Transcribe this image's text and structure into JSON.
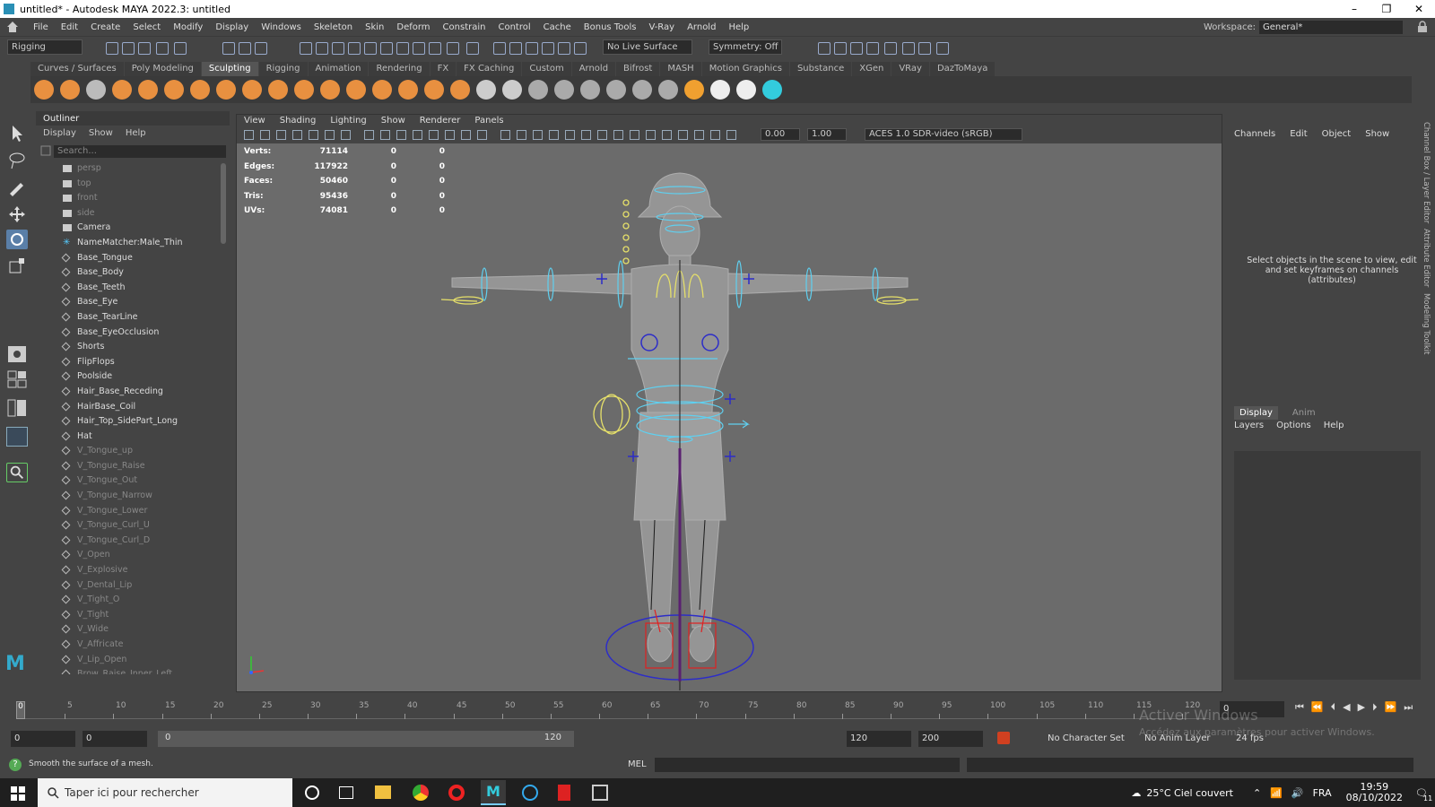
{
  "titlebar": {
    "title": "untitled* - Autodesk MAYA 2022.3: untitled",
    "min": "–",
    "max": "❐",
    "close": "✕"
  },
  "menubar": {
    "items": [
      "File",
      "Edit",
      "Create",
      "Select",
      "Modify",
      "Display",
      "Windows",
      "Skeleton",
      "Skin",
      "Deform",
      "Constrain",
      "Control",
      "Cache",
      "Bonus Tools",
      "V-Ray",
      "Arnold",
      "Help"
    ],
    "workspace_label": "Workspace:",
    "workspace_value": "General*"
  },
  "statusline": {
    "menuset": "Rigging",
    "live_surface": "No Live Surface",
    "symmetry": "Symmetry: Off"
  },
  "shelf": {
    "tabs": [
      "Curves / Surfaces",
      "Poly Modeling",
      "Sculpting",
      "Rigging",
      "Animation",
      "Rendering",
      "FX",
      "FX Caching",
      "Custom",
      "Arnold",
      "Bifrost",
      "MASH",
      "Motion Graphics",
      "Substance",
      "XGen",
      "VRay",
      "DazToMaya"
    ],
    "active_tab": "Sculpting"
  },
  "outliner": {
    "title": "Outliner",
    "menu": [
      "Display",
      "Show",
      "Help"
    ],
    "search_placeholder": "Search...",
    "items": [
      {
        "label": "persp",
        "dim": true,
        "type": "camera"
      },
      {
        "label": "top",
        "dim": true,
        "type": "camera"
      },
      {
        "label": "front",
        "dim": true,
        "type": "camera"
      },
      {
        "label": "side",
        "dim": true,
        "type": "camera"
      },
      {
        "label": "Camera",
        "dim": false,
        "type": "camera"
      },
      {
        "label": "NameMatcher:Male_Thin",
        "dim": false,
        "type": "joint"
      },
      {
        "label": "Base_Tongue",
        "dim": false,
        "type": "mesh"
      },
      {
        "label": "Base_Body",
        "dim": false,
        "type": "mesh"
      },
      {
        "label": "Base_Teeth",
        "dim": false,
        "type": "mesh"
      },
      {
        "label": "Base_Eye",
        "dim": false,
        "type": "mesh"
      },
      {
        "label": "Base_TearLine",
        "dim": false,
        "type": "mesh"
      },
      {
        "label": "Base_EyeOcclusion",
        "dim": false,
        "type": "mesh"
      },
      {
        "label": "Shorts",
        "dim": false,
        "type": "mesh"
      },
      {
        "label": "FlipFlops",
        "dim": false,
        "type": "mesh"
      },
      {
        "label": "Poolside",
        "dim": false,
        "type": "mesh"
      },
      {
        "label": "Hair_Base_Receding",
        "dim": false,
        "type": "mesh"
      },
      {
        "label": "HairBase_Coil",
        "dim": false,
        "type": "mesh"
      },
      {
        "label": "Hair_Top_SidePart_Long",
        "dim": false,
        "type": "mesh"
      },
      {
        "label": "Hat",
        "dim": false,
        "type": "mesh"
      },
      {
        "label": "V_Tongue_up",
        "dim": true,
        "type": "mesh"
      },
      {
        "label": "V_Tongue_Raise",
        "dim": true,
        "type": "mesh"
      },
      {
        "label": "V_Tongue_Out",
        "dim": true,
        "type": "mesh"
      },
      {
        "label": "V_Tongue_Narrow",
        "dim": true,
        "type": "mesh"
      },
      {
        "label": "V_Tongue_Lower",
        "dim": true,
        "type": "mesh"
      },
      {
        "label": "V_Tongue_Curl_U",
        "dim": true,
        "type": "mesh"
      },
      {
        "label": "V_Tongue_Curl_D",
        "dim": true,
        "type": "mesh"
      },
      {
        "label": "V_Open",
        "dim": true,
        "type": "mesh"
      },
      {
        "label": "V_Explosive",
        "dim": true,
        "type": "mesh"
      },
      {
        "label": "V_Dental_Lip",
        "dim": true,
        "type": "mesh"
      },
      {
        "label": "V_Tight_O",
        "dim": true,
        "type": "mesh"
      },
      {
        "label": "V_Tight",
        "dim": true,
        "type": "mesh"
      },
      {
        "label": "V_Wide",
        "dim": true,
        "type": "mesh"
      },
      {
        "label": "V_Affricate",
        "dim": true,
        "type": "mesh"
      },
      {
        "label": "V_Lip_Open",
        "dim": true,
        "type": "mesh"
      },
      {
        "label": "Brow_Raise_Inner_Left",
        "dim": true,
        "type": "mesh"
      }
    ]
  },
  "viewport": {
    "menu": [
      "View",
      "Shading",
      "Lighting",
      "Show",
      "Renderer",
      "Panels"
    ],
    "field1": "0.00",
    "field2": "1.00",
    "colorspace": "ACES 1.0 SDR-video (sRGB)",
    "hud": [
      {
        "label": "Verts:",
        "value": "71114",
        "a": "0",
        "b": "0"
      },
      {
        "label": "Edges:",
        "value": "117922",
        "a": "0",
        "b": "0"
      },
      {
        "label": "Faces:",
        "value": "50460",
        "a": "0",
        "b": "0"
      },
      {
        "label": "Tris:",
        "value": "95436",
        "a": "0",
        "b": "0"
      },
      {
        "label": "UVs:",
        "value": "74081",
        "a": "0",
        "b": "0"
      }
    ]
  },
  "channelbox": {
    "menu": [
      "Channels",
      "Edit",
      "Object",
      "Show"
    ],
    "message": "Select objects in the scene to view, edit and set keyframes on channels (attributes)",
    "layer_tabs": [
      "Display",
      "Anim"
    ],
    "layer_menu": [
      "Layers",
      "Options",
      "Help"
    ],
    "side_tabs": [
      "Channel Box / Layer Editor",
      "Attribute Editor",
      "Modeling Toolkit"
    ]
  },
  "timeslider": {
    "labels": [
      "0",
      "5",
      "10",
      "15",
      "20",
      "25",
      "30",
      "35",
      "40",
      "45",
      "50",
      "55",
      "60",
      "65",
      "70",
      "75",
      "80",
      "85",
      "90",
      "95",
      "100",
      "105",
      "110",
      "115",
      "120"
    ],
    "current": "0"
  },
  "rangeslider": {
    "start": "0",
    "anim_start": "0",
    "range_start": "0",
    "range_end": "120",
    "end": "120",
    "anim_end": "200",
    "character_set": "No Character Set",
    "anim_layer": "No Anim Layer",
    "fps": "24 fps"
  },
  "helpline": {
    "text": "Smooth the surface of a mesh.",
    "mel_label": "MEL"
  },
  "watermark": {
    "line1": "Activer Windows",
    "line2": "Accédez aux paramètres pour activer Windows."
  },
  "taskbar": {
    "search_placeholder": "Taper ici pour rechercher",
    "weather": "25°C  Ciel couvert",
    "lang": "FRA",
    "time": "19:59",
    "date": "08/10/2022",
    "notif_count": "11"
  }
}
